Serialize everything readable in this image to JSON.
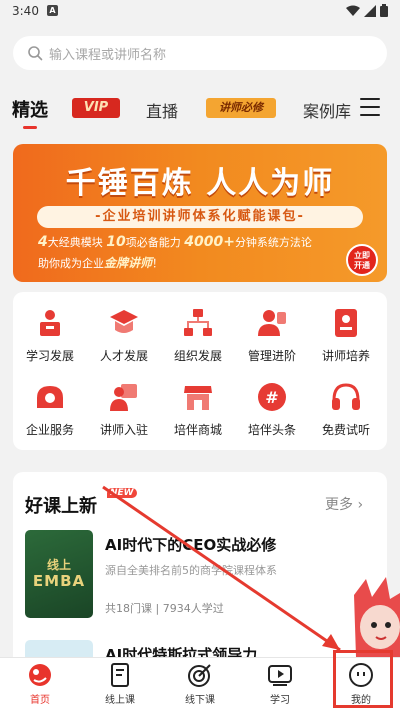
{
  "status_bar": {
    "time": "3:40",
    "notification_letter": "A"
  },
  "search": {
    "placeholder": "输入课程或讲师名称",
    "icon": "search-icon"
  },
  "tabs": [
    {
      "label": "精选",
      "active": true
    },
    {
      "label": "VIP",
      "badge": true
    },
    {
      "label": "直播"
    },
    {
      "label": "讲师必修",
      "badge": true
    },
    {
      "label": "案例库"
    }
  ],
  "banner": {
    "title": "千锤百炼 人人为师",
    "subtitle": "-企业培训讲师体系化赋能课包-",
    "line1_n1": "4",
    "line1_t1": "大经典模块",
    "line1_n2": "10",
    "line1_t2": "项必备能力",
    "line1_n3": "4000+",
    "line1_t3": "分钟系统方法论",
    "line2_pre": "助你成为企业",
    "line2_hl": "金牌讲师",
    "line2_post": "！",
    "button_line1": "立即",
    "button_line2": "开通"
  },
  "grid": [
    {
      "label": "学习发展",
      "icon": "study-development-icon"
    },
    {
      "label": "人才发展",
      "icon": "talent-development-icon"
    },
    {
      "label": "组织发展",
      "icon": "org-development-icon"
    },
    {
      "label": "管理进阶",
      "icon": "management-icon"
    },
    {
      "label": "讲师培养",
      "icon": "lecturer-training-icon"
    },
    {
      "label": "企业服务",
      "icon": "enterprise-service-icon"
    },
    {
      "label": "讲师入驻",
      "icon": "lecturer-join-icon"
    },
    {
      "label": "培伴商城",
      "icon": "store-icon"
    },
    {
      "label": "培伴头条",
      "icon": "headlines-icon"
    },
    {
      "label": "免费试听",
      "icon": "headphones-icon"
    }
  ],
  "section": {
    "title": "好课上新",
    "badge": "NEW",
    "more": "更多 ›"
  },
  "courses": [
    {
      "name": "AI时代下的CEO实战必修",
      "desc": "源自全美排名前5的商学院课程体系",
      "meta": "共18门课 | 7934人学过",
      "thumb_line1": "线上",
      "thumb_line2": "EMBA"
    },
    {
      "name": "AI时代特斯拉式领导力"
    }
  ],
  "bottom_nav": [
    {
      "label": "首页",
      "active": true
    },
    {
      "label": "线上课"
    },
    {
      "label": "线下课"
    },
    {
      "label": "学习"
    },
    {
      "label": "我的"
    }
  ],
  "colors": {
    "accent": "#e8342c",
    "banner": "#f28a1f",
    "annotation": "#e53a2f"
  }
}
